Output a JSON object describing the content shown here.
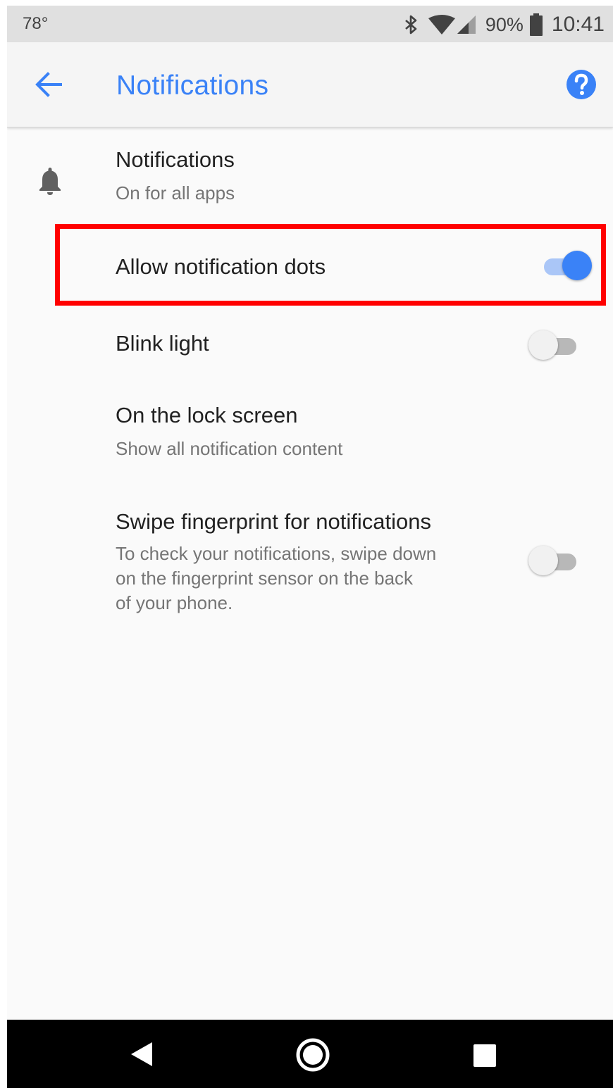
{
  "status_bar": {
    "temperature": "78°",
    "battery_percent": "90%",
    "time": "10:41",
    "icons": [
      "bluetooth-icon",
      "wifi-icon",
      "cellular-signal-icon",
      "battery-icon"
    ]
  },
  "app_bar": {
    "title": "Notifications",
    "back_icon": "arrow-back-icon",
    "help_icon": "help-icon"
  },
  "settings": {
    "notifications": {
      "title": "Notifications",
      "subtitle": "On for all apps",
      "icon": "bell-icon"
    },
    "notification_dots": {
      "title": "Allow notification dots",
      "enabled": true
    },
    "blink_light": {
      "title": "Blink light",
      "enabled": false
    },
    "lock_screen": {
      "title": "On the lock screen",
      "subtitle": "Show all notification content"
    },
    "fingerprint": {
      "title": "Swipe fingerprint for notifications",
      "subtitle_lines": [
        "To check your notifications, swipe down",
        "on the fingerprint sensor on the back",
        "of your phone."
      ],
      "enabled": false
    }
  },
  "nav_bar": {
    "icons": [
      "nav-back-icon",
      "nav-home-icon",
      "nav-recents-icon"
    ]
  },
  "colors": {
    "accent": "#3a82f7",
    "highlight_box": "#ff0000",
    "background": "#fafafa",
    "status_bar": "#e0e0e0",
    "nav_bar": "#000000"
  }
}
